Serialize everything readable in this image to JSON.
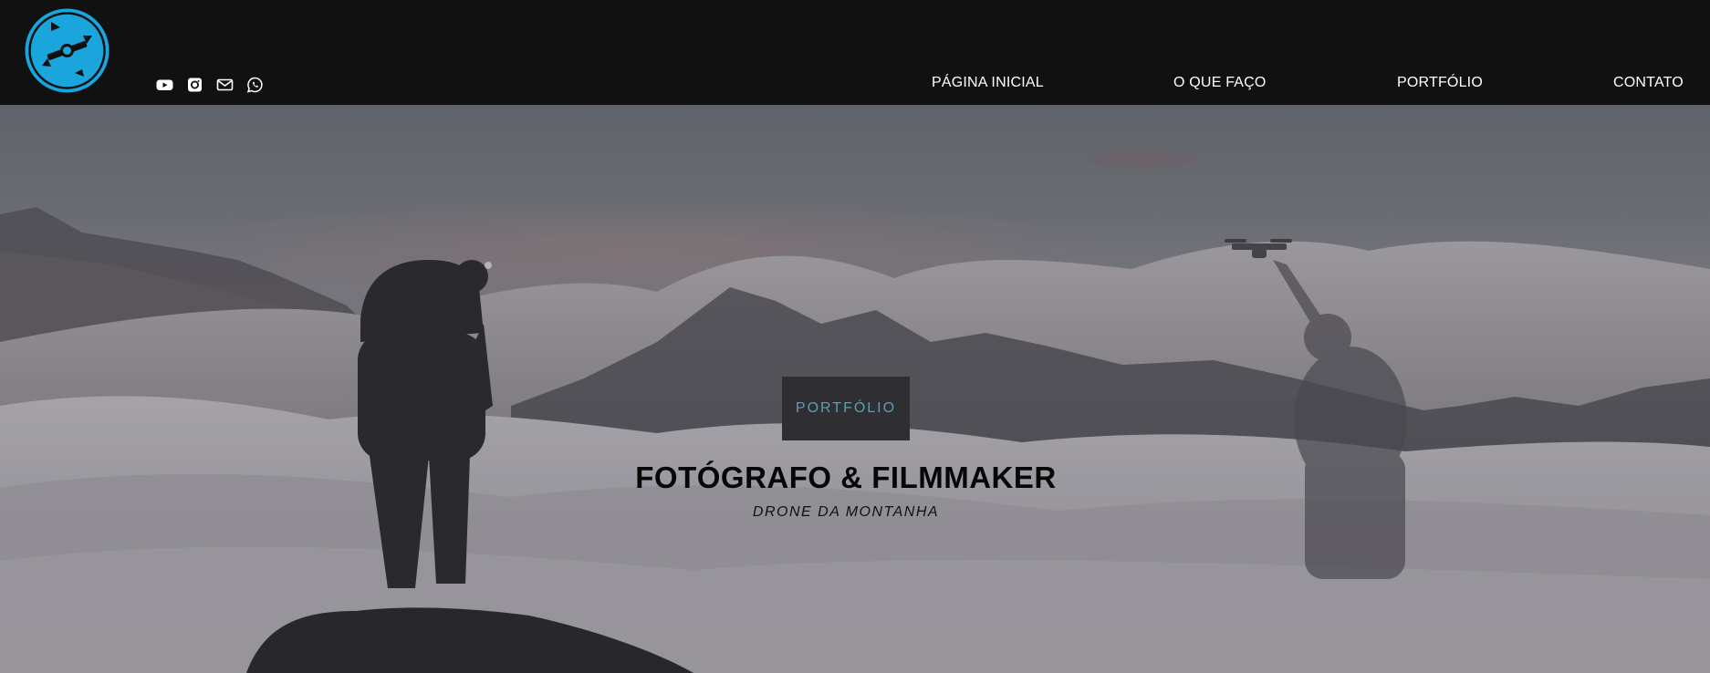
{
  "brand": {
    "logo_icon": "drone-compass-logo",
    "accent_color": "#1aa6dc"
  },
  "socials": [
    {
      "name": "youtube-icon"
    },
    {
      "name": "instagram-icon"
    },
    {
      "name": "mail-icon"
    },
    {
      "name": "whatsapp-icon"
    }
  ],
  "nav": {
    "items": [
      "PÁGINA INICIAL",
      "O QUE FAÇO",
      "PORTFÓLIO",
      "CONTATO"
    ]
  },
  "hero": {
    "button_label": "PORTFÓLIO",
    "title": "FOTÓGRAFO & FILMMAKER",
    "subtitle": "DRONE DA MONTANHA",
    "button_text_color": "#5b9fb3"
  }
}
